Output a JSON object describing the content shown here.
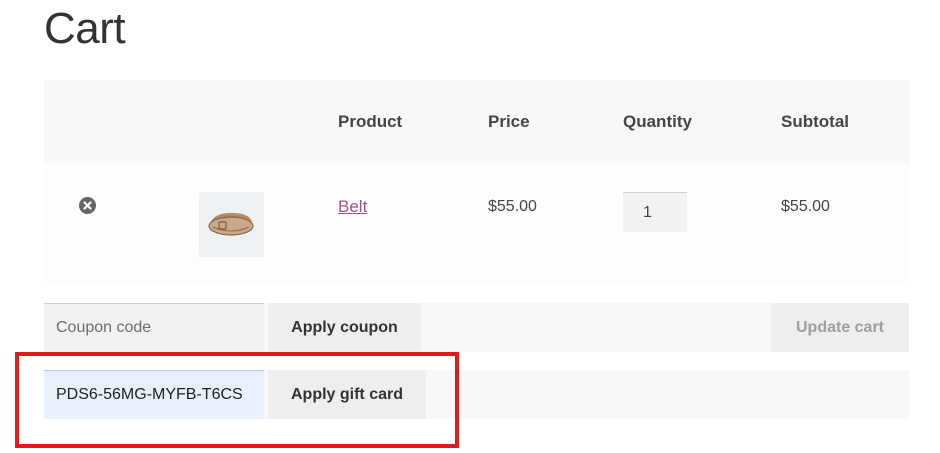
{
  "page": {
    "title": "Cart"
  },
  "table": {
    "headers": {
      "product": "Product",
      "price": "Price",
      "quantity": "Quantity",
      "subtotal": "Subtotal"
    },
    "rows": [
      {
        "product": "Belt",
        "price": "$55.00",
        "quantity": "1",
        "subtotal": "$55.00",
        "remove_icon": "close-circle-icon",
        "thumbnail_icon": "belt-image"
      }
    ]
  },
  "coupon": {
    "placeholder": "Coupon code",
    "apply_label": "Apply coupon"
  },
  "cart_actions": {
    "update_label": "Update cart"
  },
  "gift_card": {
    "value": "PDS6-56MG-MYFB-T6CS",
    "apply_label": "Apply gift card"
  },
  "colors": {
    "link": "#96588a",
    "highlight": "#e01b1b",
    "autofill": "#e8f0fe"
  }
}
